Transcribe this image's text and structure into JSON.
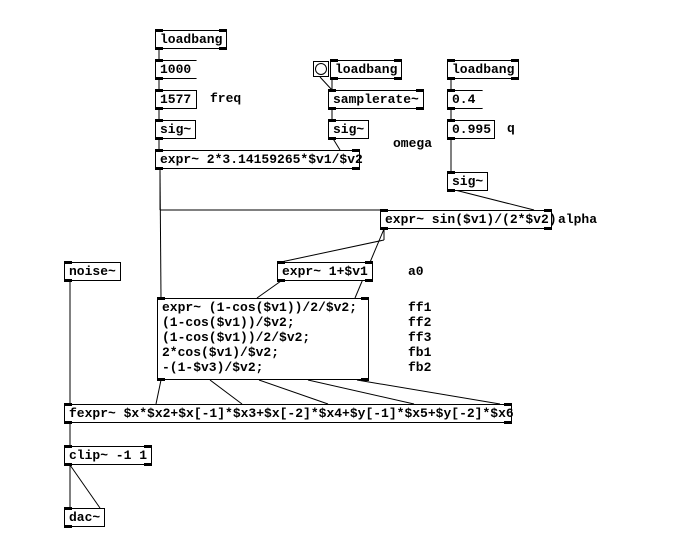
{
  "boxes": {
    "lb1": "loadbang",
    "m1000": "1000",
    "n1577": "1577",
    "sigA": "sig~",
    "omegaExpr": "expr~ 2*3.14159265*$v1/$v2",
    "lb2": "loadbang",
    "sr": "samplerate~",
    "sigB": "sig~",
    "lb3": "loadbang",
    "m04": "0.4",
    "n0995": "0.995",
    "sigC": "sig~",
    "alphaExpr": "expr~ sin($v1)/(2*$v2)",
    "a0Expr": "expr~ 1+$v1",
    "bigExpr": "expr~ (1-cos($v1))/2/$v2;\n(1-cos($v1))/$v2;\n(1-cos($v1))/2/$v2;\n2*cos($v1)/$v2;\n-(1-$v3)/$v2;",
    "noise": "noise~",
    "fexpr": "fexpr~ $x*$x2+$x[-1]*$x3+$x[-2]*$x4+$y[-1]*$x5+$y[-2]*$x6",
    "clip": "clip~ -1 1",
    "dac": "dac~"
  },
  "labels": {
    "freq": "freq",
    "omega": "omega",
    "q": "q",
    "alpha": "alpha",
    "a0": "a0",
    "ff1": "ff1",
    "ff2": "ff2",
    "ff3": "ff3",
    "fb1": "fb1",
    "fb2": "fb2"
  }
}
